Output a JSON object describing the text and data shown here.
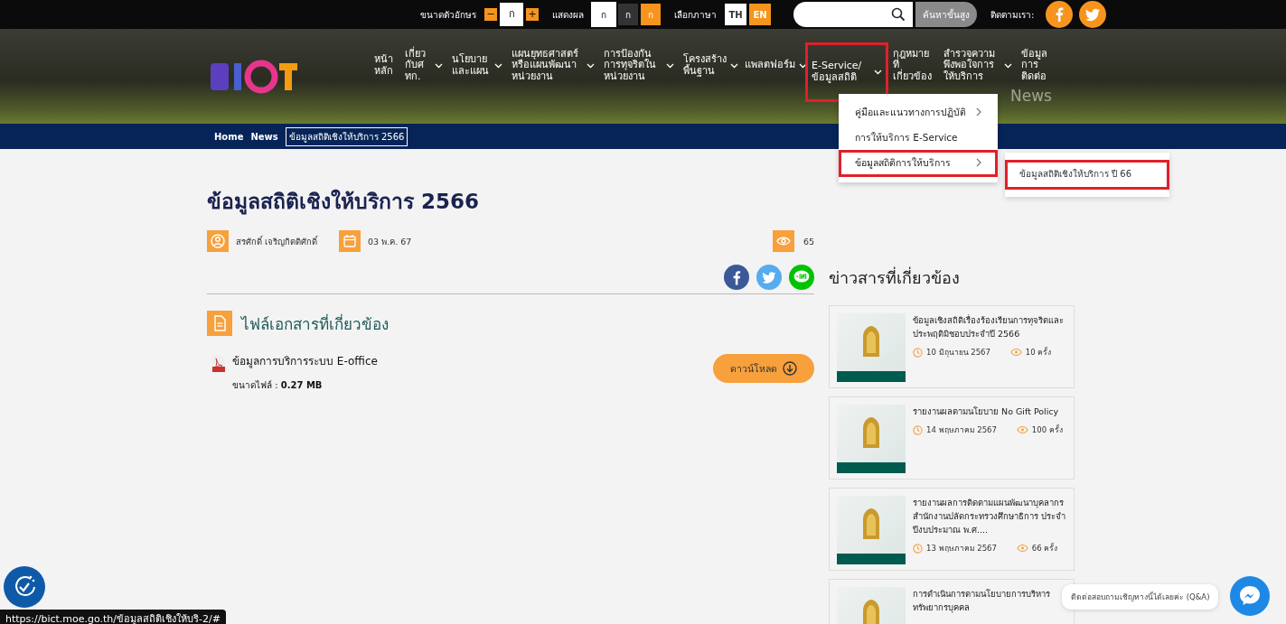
{
  "topbar": {
    "font_size_label": "ขนาดตัวอักษร",
    "font_sizes": [
      {
        "label": "−",
        "kind": "minus"
      },
      {
        "label": "ก",
        "kind": "normal"
      },
      {
        "label": "+",
        "kind": "plus"
      }
    ],
    "display_label": "แสดงผล",
    "display_modes": [
      {
        "label": "ก",
        "kind": "light",
        "selected": true
      },
      {
        "label": "ก",
        "kind": "dark",
        "selected": false
      },
      {
        "label": "ก",
        "kind": "orange",
        "selected": false
      }
    ],
    "language_label": "เลือกภาษา",
    "languages": [
      {
        "label": "TH",
        "selected": false
      },
      {
        "label": "EN",
        "selected": true
      }
    ],
    "search": {
      "advanced": "ค้นหาขั้นสูง"
    },
    "follow_label": "ติดตามเรา:"
  },
  "nav": [
    {
      "label": "หน้าหลัก",
      "dropdown": false,
      "highlighted": false
    },
    {
      "label": "เกี่ยวกับศทก.",
      "dropdown": true,
      "highlighted": false
    },
    {
      "label": "นโยบายและแผน",
      "dropdown": true,
      "highlighted": false
    },
    {
      "label": "แผนยุทธศาสตร์หรือแผนพัฒนาหน่วยงาน",
      "dropdown": true,
      "highlighted": false
    },
    {
      "label": "การป้องกันการทุจริตในหน่วยงาน",
      "dropdown": true,
      "highlighted": false
    },
    {
      "label": "โครงสร้างพื้นฐาน",
      "dropdown": true,
      "highlighted": false
    },
    {
      "label": "แพลตฟอร์ม",
      "dropdown": true,
      "highlighted": false
    },
    {
      "label": "E-Service/ข้อมูลสถิติ",
      "dropdown": true,
      "highlighted": true
    },
    {
      "label": "กฎหมายที่เกี่ยวข้อง",
      "dropdown": false,
      "highlighted": false
    },
    {
      "label": "สำรวจความพึงพอใจการให้บริการ",
      "dropdown": true,
      "highlighted": false
    },
    {
      "label": "ข้อมูลการติดต่อ",
      "dropdown": false,
      "highlighted": false
    }
  ],
  "banner_text": "News",
  "dropdown_menu": [
    {
      "label": "คู่มือและแนวทางการปฏิบัติ",
      "submenu": true,
      "highlighted": false
    },
    {
      "label": "การให้บริการ E-Service",
      "submenu": false,
      "highlighted": false
    },
    {
      "label": "ข้อมูลสถิติการให้บริการ",
      "submenu": true,
      "highlighted": true
    }
  ],
  "submenu": [
    {
      "label": "ข้อมูลสถิติเชิงให้บริการ ปี 66",
      "highlighted": true
    }
  ],
  "breadcrumb": [
    {
      "label": "Home",
      "selected": false
    },
    {
      "label": "News",
      "selected": false
    },
    {
      "label": "ข้อมูลสถิติเชิงให้บริการ 2566",
      "selected": true
    }
  ],
  "article": {
    "title": "ข้อมูลสถิติเชิงให้บริการ 2566",
    "author": "สรศักดิ์ เจริญกิตติศักดิ์",
    "date": "03 พ.ค. 67",
    "views": "65",
    "files_heading": "ไฟล์เอกสารที่เกี่ยวข้อง",
    "files": [
      {
        "name": "ข้อมูลการบริการระบบ E-office",
        "size_label": "ขนาดไฟล์ :",
        "size": "0.27 MB",
        "download": "ดาวน์โหลด"
      }
    ]
  },
  "related": {
    "heading": "ข่าวสารที่เกี่ยวข้อง",
    "items": [
      {
        "title": "ข้อมูลเชิงสถิติเรื่องร้องเรียนการทุจริตและประพฤติมิชอบประจำปี 2566",
        "date": "10 มิถุนายน 2567",
        "views": "10 ครั้ง"
      },
      {
        "title": "รายงานผลตามนโยบาย No Gift Policy",
        "date": "14 พฤษภาคม 2567",
        "views": "100 ครั้ง"
      },
      {
        "title": "รายงานผลการติดตามแผนพัฒนาบุคลากรสำนักงานปลัดกระทรวงศึกษาธิการ ประจำปีงบประมาณ พ.ศ....",
        "date": "13 พฤษภาคม 2567",
        "views": "66 ครั้ง"
      },
      {
        "title": "การดำเนินการตามนโยบายการบริหารทรัพยากรบุคคล"
      }
    ]
  },
  "chat_prompt": "ติดต่อสอบถามเชิญทางนี้ได้เลยค่ะ (Q&A)",
  "status_url": "https://bict.moe.go.th/ข้อมูลสถิติเชิงให้บริ-2/#"
}
